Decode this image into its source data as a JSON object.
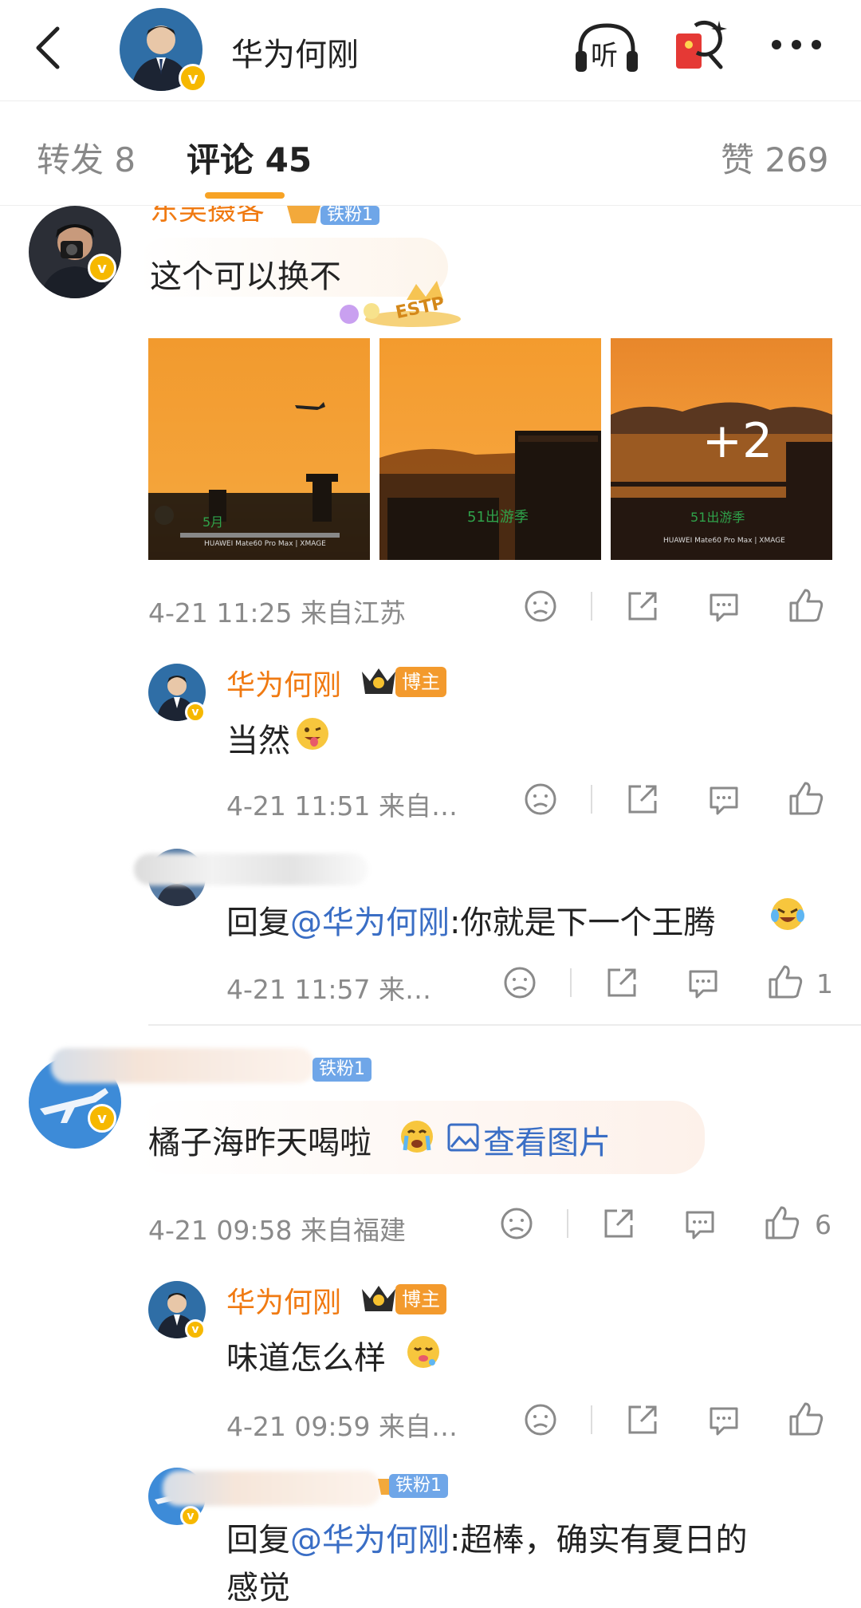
{
  "header": {
    "title": "华为何刚",
    "listen_label": "听"
  },
  "tabs": {
    "repost": "转发 8",
    "comments": "评论 45",
    "likes": "赞 269"
  },
  "comments": [
    {
      "id": "c1",
      "name": "东吴摄客",
      "fan_badge": "铁粉1",
      "text": "这个可以换不",
      "sticker_text": "ESTP",
      "images_more": "+2",
      "image_caption": "HUAWEI Mate60 Pro Max | XMAGE",
      "meta": "4-21 11:25  来自江苏",
      "replies": [
        {
          "name": "华为何刚",
          "badge": "博主",
          "text": "当然",
          "meta": "4-21 11:51  来自…"
        },
        {
          "text_prefix": "回复",
          "mention": "@华为何刚",
          "text_suffix": ":你就是下一个王腾",
          "meta": "4-21 11:57  来…",
          "like_count": "1"
        }
      ]
    },
    {
      "id": "c2",
      "fan_badge": "铁粉1",
      "text": "橘子海昨天喝啦",
      "view_image": "查看图片",
      "meta": "4-21 09:58  来自福建",
      "like_count": "6",
      "replies": [
        {
          "name": "华为何刚",
          "badge": "博主",
          "text": "味道怎么样",
          "meta": "4-21 09:59  来自…"
        },
        {
          "fan_badge": "铁粉1",
          "text_prefix": "回复",
          "mention": "@华为何刚",
          "text_suffix": ":超棒，确实有夏日的",
          "text_line2": "感觉"
        }
      ]
    }
  ],
  "colors": {
    "accent_orange": "#f07a12",
    "mention_blue": "#3a6ec5",
    "tab_underline": "#f7a325",
    "verified_gold": "#f6b800"
  }
}
